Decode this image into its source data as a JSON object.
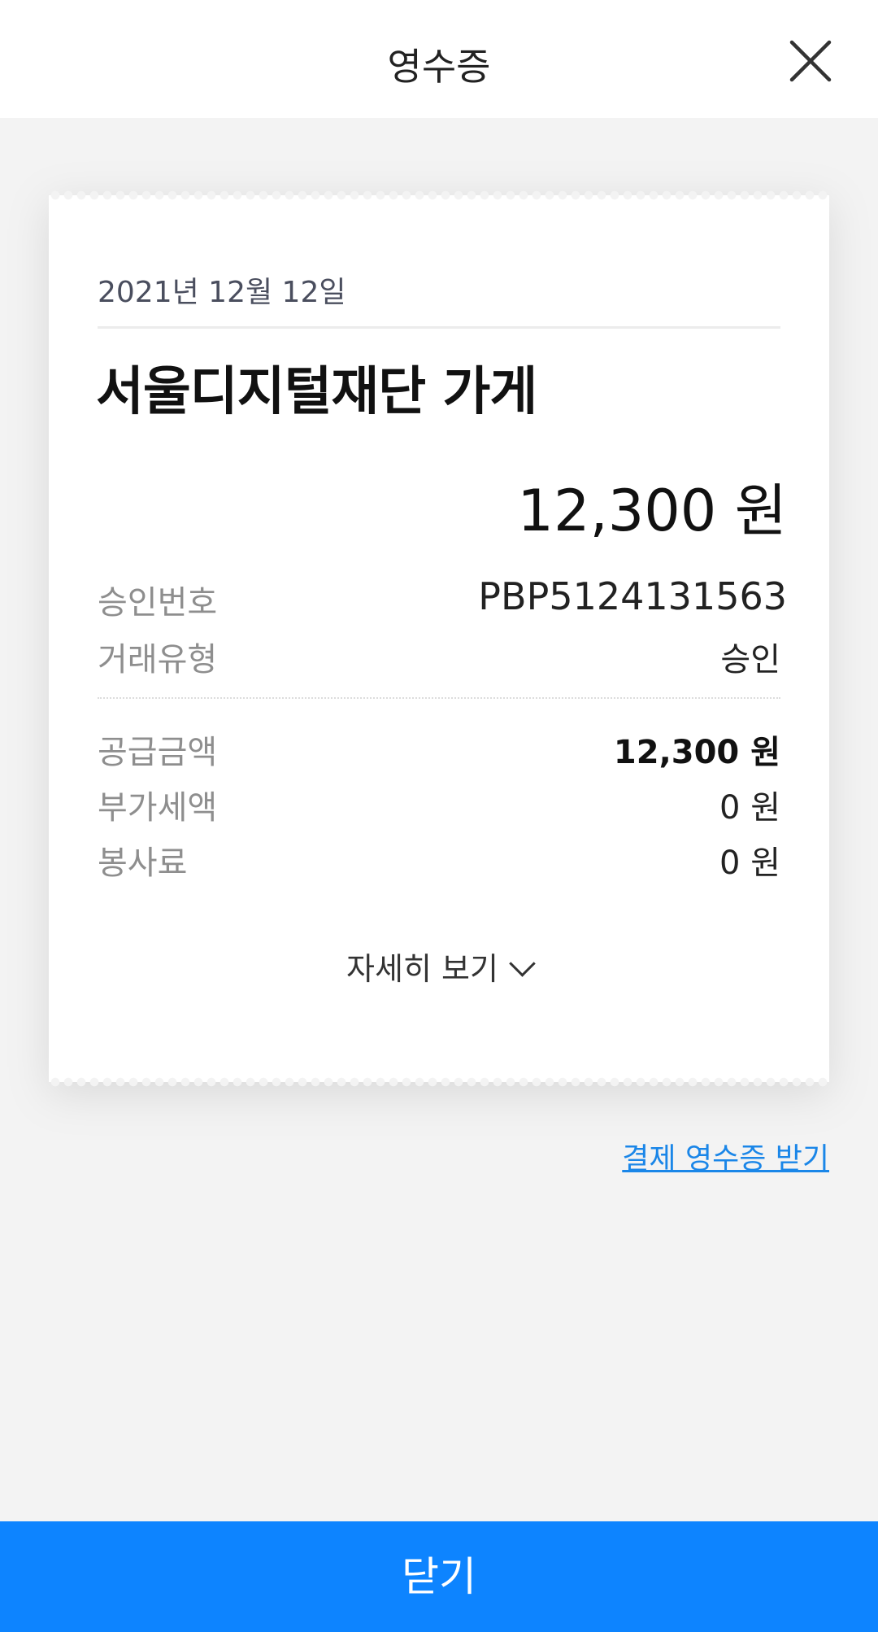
{
  "header": {
    "title": "영수증",
    "close_icon": "close-icon"
  },
  "receipt": {
    "date": "2021년 12월 12일",
    "store_name": "서울디지털재단 가게",
    "total": "12,300 원",
    "approval_number_label": "승인번호",
    "approval_number": "PBP5124131563",
    "transaction_type_label": "거래유형",
    "transaction_type": "승인",
    "supply_amount_label": "공급금액",
    "supply_amount": "12,300 원",
    "vat_label": "부가세액",
    "vat": "0 원",
    "service_charge_label": "봉사료",
    "service_charge": "0 원",
    "detail_toggle_label": "자세히 보기"
  },
  "links": {
    "payment_receipt": "결제 영수증 받기"
  },
  "footer": {
    "close_label": "닫기"
  },
  "colors": {
    "accent": "#0d84ff",
    "link": "#1a86e8",
    "background": "#f3f3f3"
  }
}
